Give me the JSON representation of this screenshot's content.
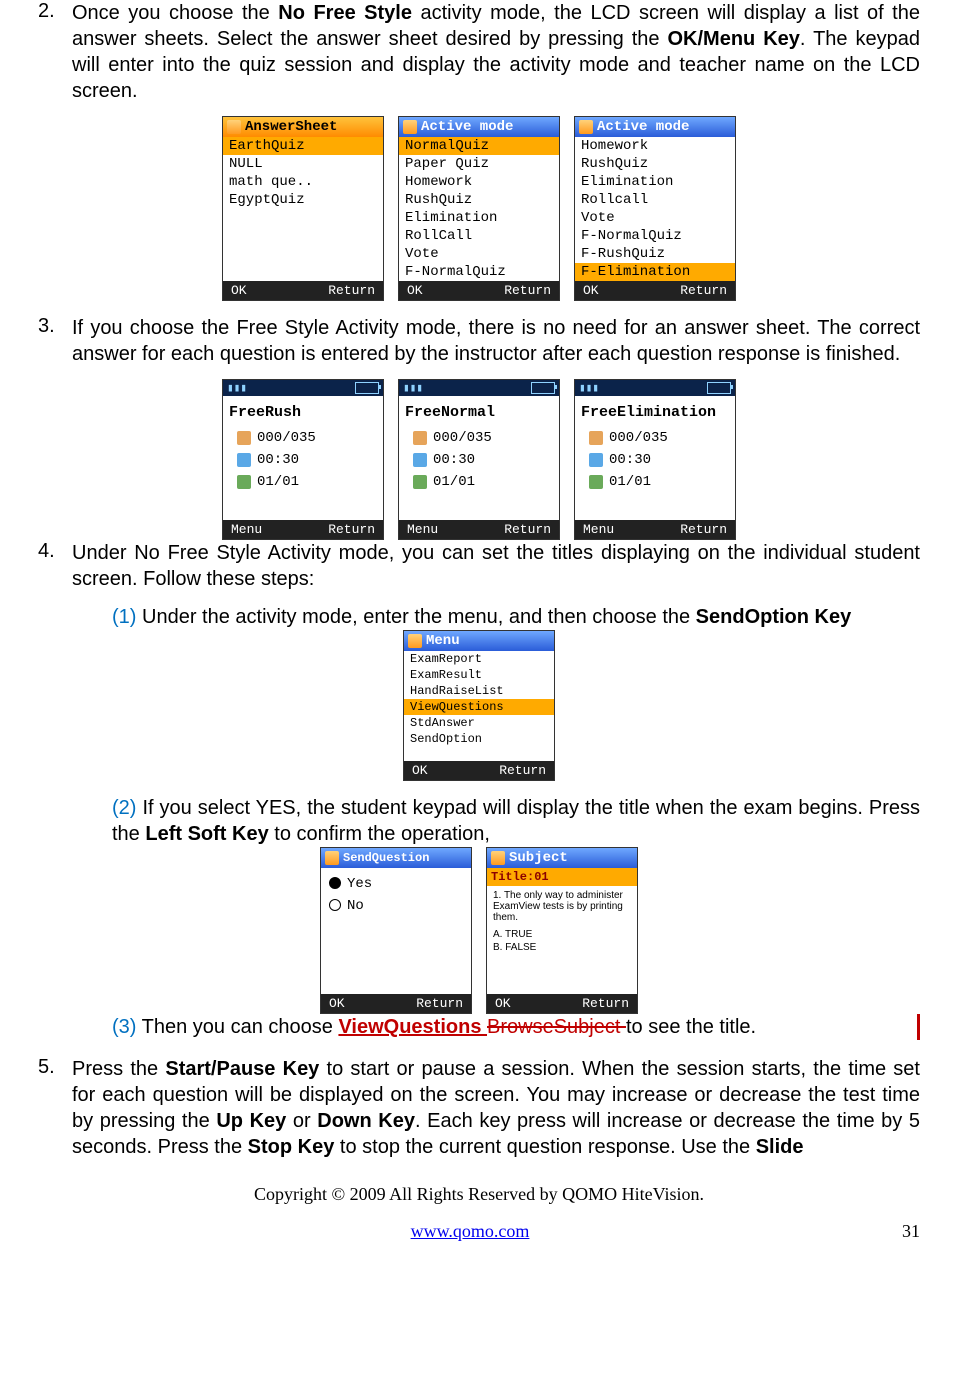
{
  "step2": {
    "num": "2.",
    "text_before_bold1": "Once you choose the ",
    "bold1": "No Free Style",
    "text_mid1": " activity mode, the LCD screen will display a list of the answer sheets. Select the answer sheet desired by pressing the ",
    "bold2": "OK/Menu Key",
    "text_after": ". The keypad will enter into the quiz session and display the activity mode and teacher name on the LCD screen."
  },
  "row1": {
    "screen1": {
      "title": "AnswerSheet",
      "items": [
        "EarthQuiz",
        "NULL",
        "math que..",
        "EgyptQuiz"
      ],
      "hl_index": 0,
      "ok": "OK",
      "ret": "Return"
    },
    "screen2": {
      "title": "Active mode",
      "items": [
        "NormalQuiz",
        "Paper Quiz",
        "Homework",
        "RushQuiz",
        "Elimination",
        "RollCall",
        "Vote",
        "F-NormalQuiz"
      ],
      "hl_index": 0,
      "ok": "OK",
      "ret": "Return"
    },
    "screen3": {
      "title": "Active mode",
      "items": [
        "Homework",
        "RushQuiz",
        "Elimination",
        "Rollcall",
        "Vote",
        "F-NormalQuiz",
        "F-RushQuiz",
        "F-Elimination"
      ],
      "hl_index": 7,
      "ok": "OK",
      "ret": "Return"
    }
  },
  "step3": {
    "num": "3.",
    "text": "If you choose the Free Style Activity mode, there is no need for an answer sheet. The correct answer for each question is entered by the instructor after each question response is finished."
  },
  "row2": {
    "s1": {
      "label": "FreeRush",
      "count": "000/035",
      "time": "00:30",
      "q": "01/01",
      "menu": "Menu",
      "ret": "Return"
    },
    "s2": {
      "label": "FreeNormal",
      "count": "000/035",
      "time": "00:30",
      "q": "01/01",
      "menu": "Menu",
      "ret": "Return"
    },
    "s3": {
      "label": "FreeElimination",
      "count": "000/035",
      "time": "00:30",
      "q": "01/01",
      "menu": "Menu",
      "ret": "Return"
    }
  },
  "step4": {
    "num": "4.",
    "text": "Under No Free Style Activity mode, you can set the titles displaying on the individual student screen. Follow these steps:"
  },
  "sub1": {
    "num": "(1) ",
    "t1": "Under the activity mode, enter the menu, and then choose the ",
    "bold": "SendOption Key"
  },
  "menuScreen": {
    "title": "Menu",
    "items": [
      "ExamReport",
      "ExamResult",
      "HandRaiseList",
      "ViewQuestions",
      "StdAnswer",
      "SendOption"
    ],
    "hl_index": 3,
    "ok": "OK",
    "ret": "Return"
  },
  "sub2": {
    "num": "(2) ",
    "t1": "If you select YES, the student keypad will display the title when the exam begins. Press the ",
    "bold": "Left Soft Key",
    "t2": " to confirm the operation,"
  },
  "sendQ": {
    "title": "SendQuestion",
    "yes": "Yes",
    "no": "No",
    "ok": "OK",
    "ret": "Return"
  },
  "subject": {
    "title": "Subject",
    "titleRow": "Title:01",
    "q": "1. The only way to administer ExamView tests is by printing them.",
    "a": "A. TRUE",
    "b": "B. FALSE",
    "ok": "OK",
    "ret": "Return"
  },
  "sub3": {
    "num": "(3) ",
    "t1": "Then you can choose ",
    "ins": "ViewQuestions ",
    "del": "BrowseSubject ",
    "t2": "to see the title."
  },
  "step5": {
    "num": "5.",
    "t1": "Press the ",
    "b1": "Start/Pause Key",
    "t2": " to start or pause a session. When the session starts, the time set for each question will be displayed on the screen. You may increase or decrease the test time by pressing the ",
    "b2": "Up Key",
    "t3": " or ",
    "b3": "Down Key",
    "t4": ". Each key press will increase or decrease the time by 5 seconds. Press the ",
    "b4": "Stop Key",
    "t5": " to stop the current question response. Use the ",
    "b5": "Slide"
  },
  "footer": {
    "copy": "Copyright © 2009 All Rights Reserved by QOMO HiteVision.",
    "link": "www.qomo.com",
    "page": "31"
  }
}
